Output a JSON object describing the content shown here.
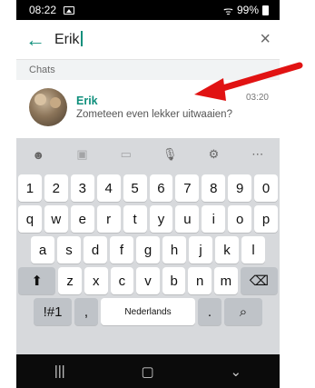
{
  "status": {
    "time": "08:22",
    "battery": "99%"
  },
  "search": {
    "query": "Erik"
  },
  "section": {
    "label": "Chats"
  },
  "chat": {
    "name": "Erik",
    "message": "Zometeen even lekker uitwaaien?",
    "time": "03:20"
  },
  "keyboard": {
    "row1": [
      "1",
      "2",
      "3",
      "4",
      "5",
      "6",
      "7",
      "8",
      "9",
      "0"
    ],
    "row2": [
      "q",
      "w",
      "e",
      "r",
      "t",
      "y",
      "u",
      "i",
      "o",
      "p"
    ],
    "row3": [
      "a",
      "s",
      "d",
      "f",
      "g",
      "h",
      "j",
      "k",
      "l"
    ],
    "row4": [
      "z",
      "x",
      "c",
      "v",
      "b",
      "n",
      "m"
    ],
    "symbols": "!#1",
    "comma": ",",
    "space": "Nederlands",
    "period": "."
  },
  "colors": {
    "accent": "#0f8f7c",
    "arrow": "#e11313"
  }
}
